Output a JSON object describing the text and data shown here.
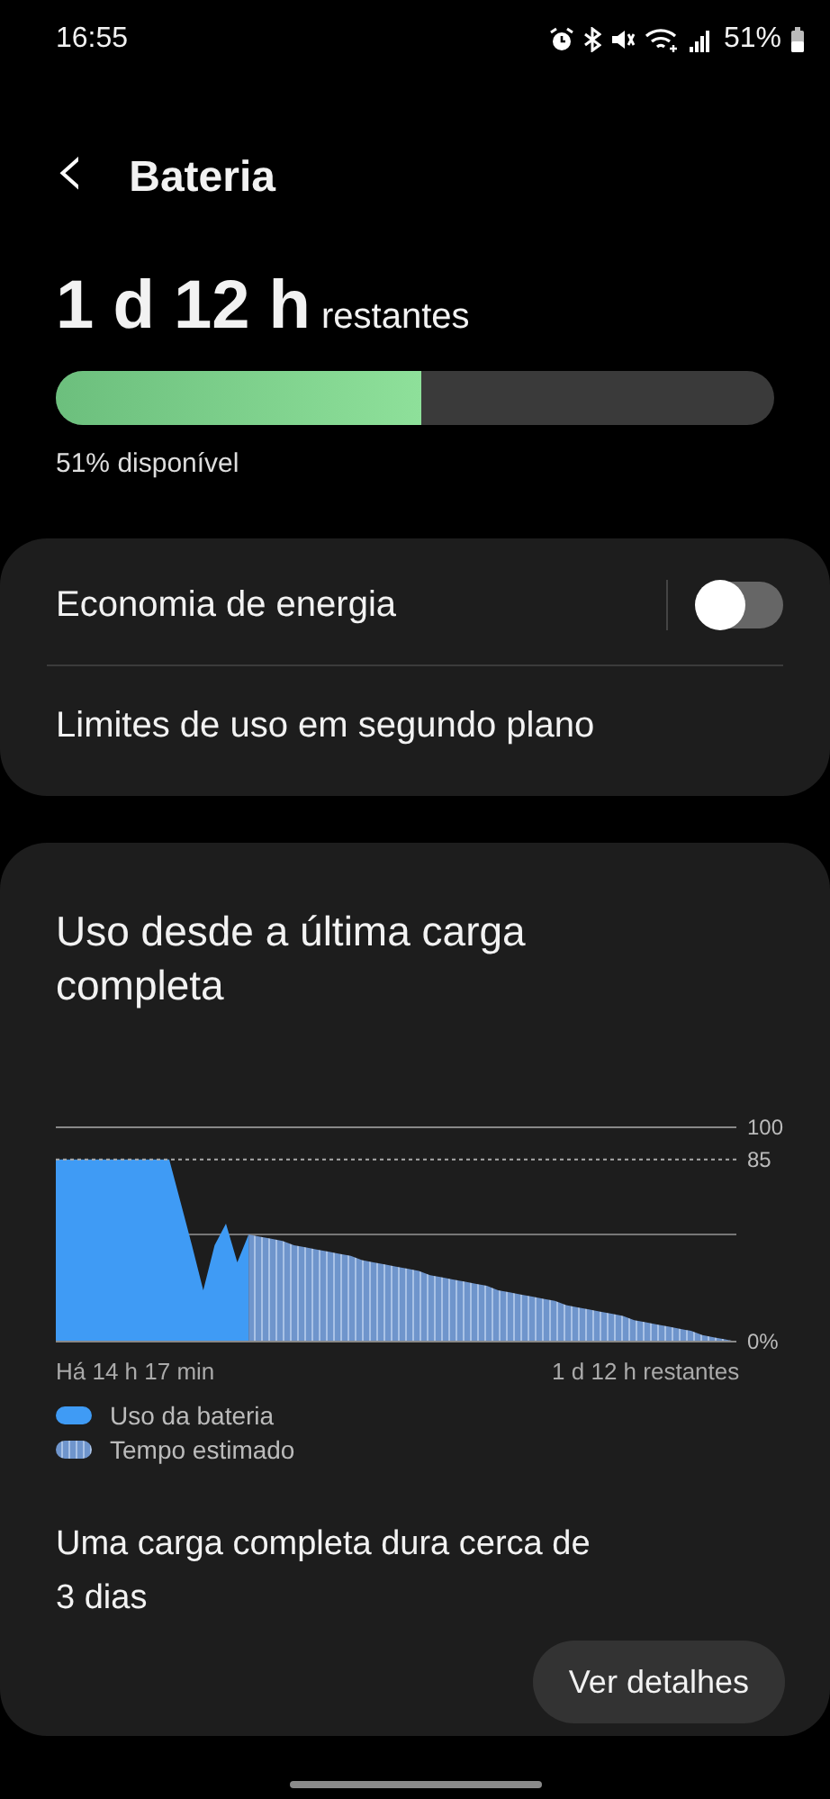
{
  "status_bar": {
    "time": "16:55",
    "battery_text": "51%"
  },
  "header": {
    "back_glyph": "‹",
    "title": "Bateria"
  },
  "remaining": {
    "value": "1 d 12 h",
    "suffix": "restantes",
    "level": 0.51,
    "available": "51% disponível"
  },
  "settings": [
    {
      "label": "Economia de energia",
      "kind": "toggle",
      "on": false
    },
    {
      "label": "Limites de uso em segundo plano",
      "kind": "link"
    }
  ],
  "usage_card": {
    "title": "Uso desde a última carga completa",
    "chart_data": {
      "type": "area",
      "categories": [
        null,
        null,
        null,
        null,
        null,
        null,
        null,
        "Há 14 h 17 min",
        null,
        null,
        null,
        null,
        null,
        null,
        null,
        null,
        null,
        null,
        null,
        null,
        null,
        null,
        null,
        null,
        null,
        null,
        null,
        null,
        null,
        null,
        null,
        null,
        null,
        null,
        null,
        null,
        null,
        null,
        null,
        null,
        null,
        null,
        null,
        null,
        null,
        null,
        null,
        null,
        null,
        null,
        null,
        null,
        "1 d 12 h restantes",
        null,
        null,
        null,
        null,
        null,
        null,
        null,
        null
      ],
      "yticks": [
        {
          "value": 0,
          "label": "0%"
        },
        {
          "value": 85,
          "label": "85"
        },
        {
          "value": 100,
          "label": "100"
        }
      ],
      "ylim": [
        0,
        100
      ],
      "ref_lines": [
        {
          "axis": "y",
          "value": 50
        }
      ],
      "series": [
        {
          "name": "Uso da bateria",
          "color": "#3f9bf5",
          "values": [
            85,
            85,
            85,
            85,
            85,
            85,
            85,
            85,
            85,
            85,
            85,
            65,
            45,
            24,
            45,
            55,
            37,
            50,
            null,
            null,
            null,
            null,
            null,
            null,
            null,
            null,
            null,
            null,
            null,
            null,
            null,
            null,
            null,
            null,
            null,
            null,
            null,
            null,
            null,
            null,
            null,
            null,
            null,
            null,
            null,
            null,
            null,
            null,
            null,
            null,
            null,
            null,
            null,
            null,
            null,
            null,
            null,
            null,
            null,
            null,
            null
          ]
        },
        {
          "name": "Tempo estimado",
          "color": "#6f95cc",
          "values": [
            null,
            null,
            null,
            null,
            null,
            null,
            null,
            null,
            null,
            null,
            null,
            null,
            null,
            null,
            null,
            null,
            null,
            50,
            49,
            48,
            47,
            45,
            44,
            43,
            42,
            41,
            40,
            38,
            37,
            36,
            35,
            34,
            33,
            31,
            30,
            29,
            28,
            27,
            26,
            24,
            23,
            22,
            21,
            20,
            19,
            17,
            16,
            15,
            14,
            13,
            12,
            10,
            9,
            8,
            7,
            6,
            5,
            3,
            2,
            1,
            0
          ]
        }
      ]
    },
    "summary_line1": "Uma carga completa dura cerca de",
    "summary_line2": "3 dias",
    "details_button": "Ver detalhes"
  }
}
